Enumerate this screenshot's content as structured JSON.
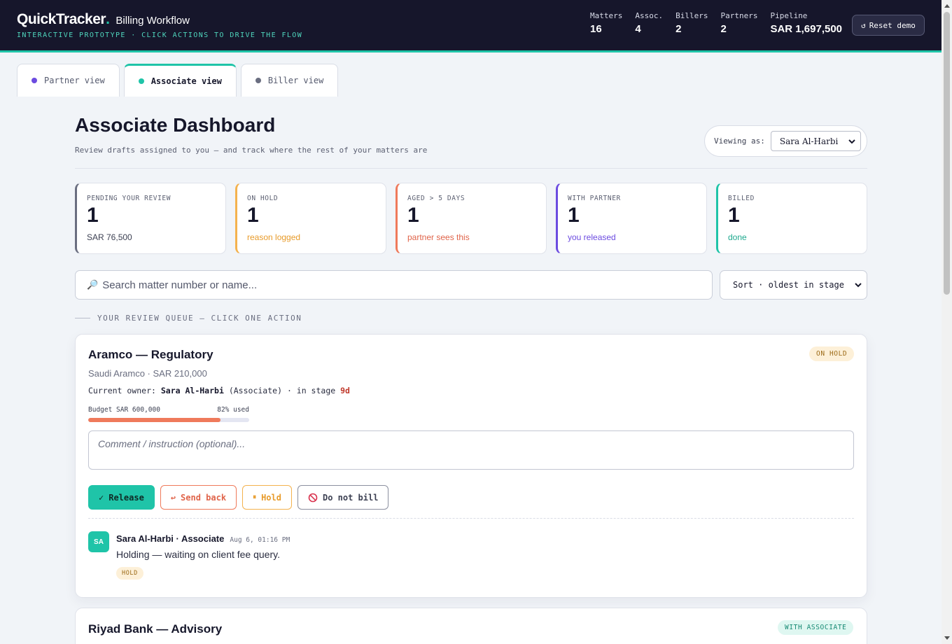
{
  "header": {
    "brand": "QuickTracker",
    "brand_dot": ".",
    "subtitle": "Billing Workflow",
    "tagline": "INTERACTIVE PROTOTYPE · CLICK ACTIONS TO DRIVE THE FLOW",
    "stats": [
      {
        "label": "Matters",
        "value": "16"
      },
      {
        "label": "Assoc.",
        "value": "4"
      },
      {
        "label": "Billers",
        "value": "2"
      },
      {
        "label": "Partners",
        "value": "2"
      },
      {
        "label": "Pipeline",
        "value": "SAR 1,697,500"
      }
    ],
    "reset_icon": "↺",
    "reset_label": "Reset demo"
  },
  "tabs": [
    {
      "label": "Partner view",
      "dot_color": "#6c4be0",
      "active": false
    },
    {
      "label": "Associate view",
      "dot_color": "#1fc4a8",
      "active": true
    },
    {
      "label": "Biller view",
      "dot_color": "#6a6e80",
      "active": false
    }
  ],
  "page": {
    "title": "Associate Dashboard",
    "subtitle": "Review drafts assigned to you — and track where the rest of your matters are",
    "viewing_label": "Viewing as:",
    "viewing_value": "Sara Al-Harbi"
  },
  "kpis": [
    {
      "label": "PENDING YOUR REVIEW",
      "value": "1",
      "foot": "SAR 76,500",
      "color": "#6a6e80",
      "foot_color": "#3c4052"
    },
    {
      "label": "ON HOLD",
      "value": "1",
      "foot": "reason logged",
      "color": "#f4b24e",
      "foot_color": "#e89b2a"
    },
    {
      "label": "AGED > 5 DAYS",
      "value": "1",
      "foot": "partner sees this",
      "color": "#ef7a5b",
      "foot_color": "#e0644a"
    },
    {
      "label": "WITH PARTNER",
      "value": "1",
      "foot": "you released",
      "color": "#6c4be0",
      "foot_color": "#6c4be0"
    },
    {
      "label": "BILLED",
      "value": "1",
      "foot": "done",
      "color": "#1fc4a8",
      "foot_color": "#1fa98f"
    }
  ],
  "search": {
    "icon": "🔎",
    "placeholder": "Search matter number or name..."
  },
  "sort": {
    "value": "Sort · oldest in stage"
  },
  "queue_label": "YOUR REVIEW QUEUE — CLICK ONE ACTION",
  "matters": [
    {
      "title": "Aramco — Regulatory",
      "sub": "Saudi Aramco · SAR 210,000",
      "owner_prefix": "Current owner:",
      "owner_name": "Sara Al-Harbi",
      "owner_role": "(Associate)",
      "stage_prefix": "· in stage",
      "stage_days": "9d",
      "badge": "ON HOLD",
      "budget_label": "Budget SAR 600,000",
      "budget_used_label": "82% used",
      "budget_used": 0.82,
      "comment_placeholder": "Comment / instruction (optional)...",
      "actions": {
        "release": "Release",
        "release_icon": "✓",
        "send_back": "Send back",
        "send_back_icon": "↩",
        "hold": "Hold",
        "hold_icon": "⏸",
        "do_not_bill": "Do not bill",
        "do_not_bill_icon": "⃠"
      },
      "log": {
        "initials": "SA",
        "author": "Sara Al-Harbi · Associate",
        "time": "Aug 6, 01:16 PM",
        "text": "Holding — waiting on client fee query.",
        "tag": "HOLD"
      }
    },
    {
      "title": "Riyad Bank — Advisory",
      "badge": "WITH ASSOCIATE"
    }
  ]
}
